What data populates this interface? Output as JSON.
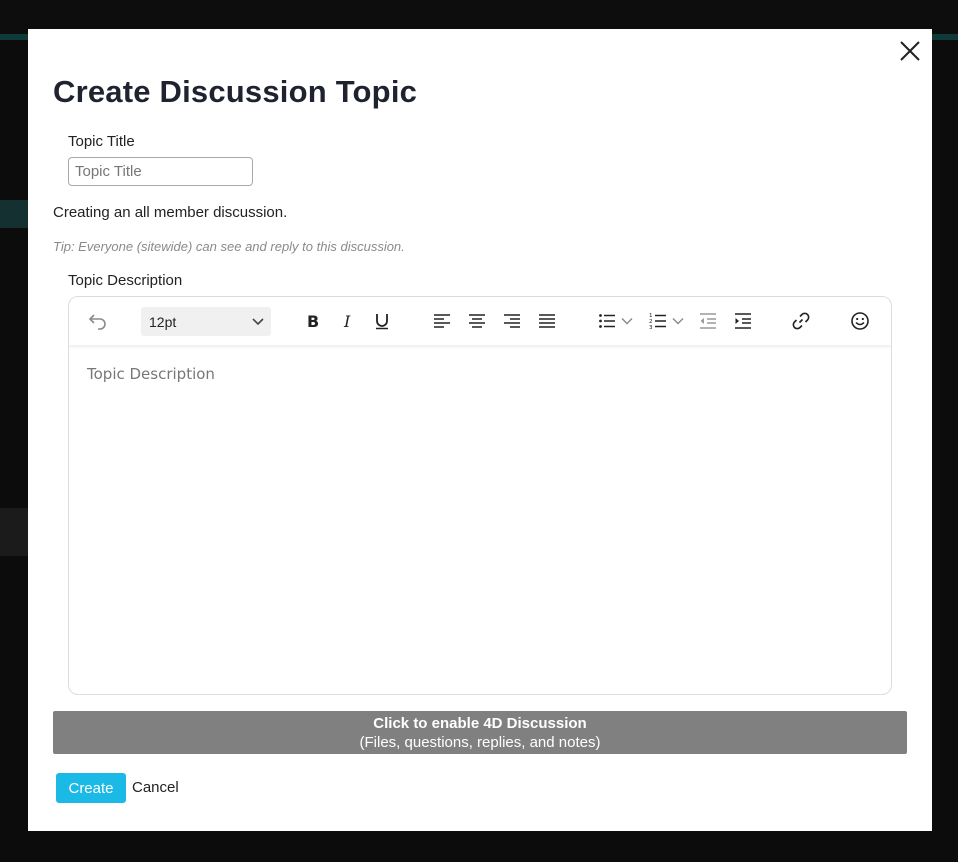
{
  "modal": {
    "title": "Create Discussion Topic",
    "topic_title_label": "Topic Title",
    "topic_title_placeholder": "Topic Title",
    "topic_title_value": "",
    "info_text": "Creating an all member discussion.",
    "tip_text": "Tip: Everyone (sitewide) can see and reply to this discussion.",
    "description_label": "Topic Description",
    "description_placeholder": "Topic Description",
    "toolbar": {
      "font_size": "12pt",
      "icons": [
        "undo-icon",
        "bold-icon",
        "italic-icon",
        "underline-icon",
        "align-left-icon",
        "align-center-icon",
        "align-right-icon",
        "align-justify-icon",
        "bullet-list-icon",
        "numbered-list-icon",
        "outdent-icon",
        "indent-icon",
        "link-icon",
        "emoji-icon"
      ]
    },
    "enable_4d": {
      "line1": "Click to enable 4D Discussion",
      "line2": "(Files, questions, replies, and notes)"
    },
    "create_label": "Create",
    "cancel_label": "Cancel"
  },
  "colors": {
    "overlay": "#0c0c0c",
    "create_button": "#1ab9e6",
    "enable_bar": "#808080",
    "title_text": "#1f2330"
  }
}
